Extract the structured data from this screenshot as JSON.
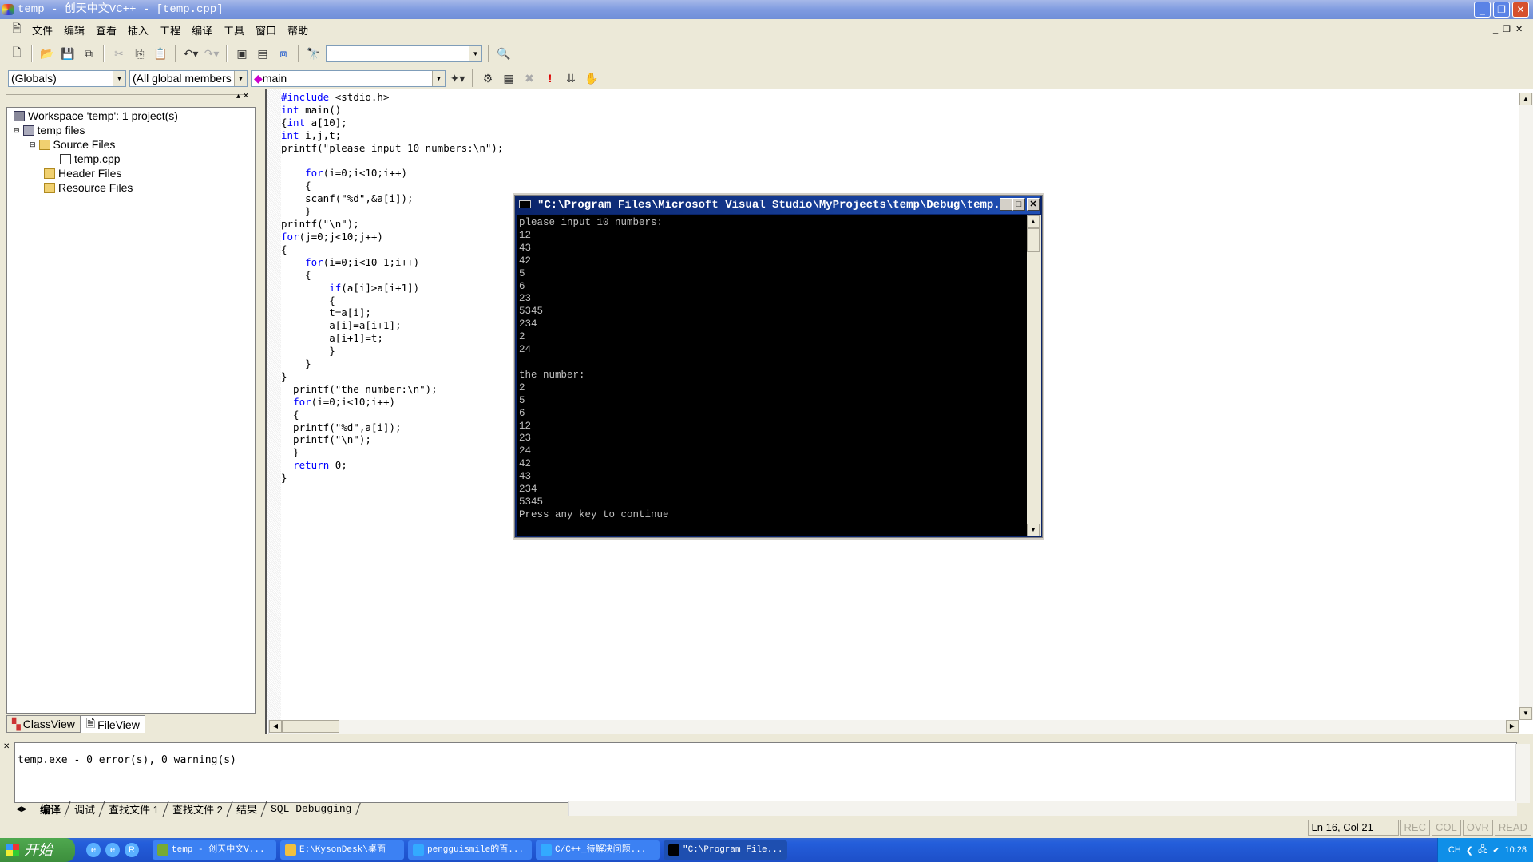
{
  "window": {
    "title": "temp - 创天中文VC++ - [temp.cpp]"
  },
  "menu": [
    "文件",
    "编辑",
    "查看",
    "插入",
    "工程",
    "编译",
    "工具",
    "窗口",
    "帮助"
  ],
  "toolbar": {
    "find_combo_value": ""
  },
  "wizardbar": {
    "class_combo": "(Globals)",
    "filter_combo": "(All global members",
    "member_combo": "main"
  },
  "workspace": {
    "items": [
      {
        "label": "Workspace 'temp': 1 project(s)",
        "icon": "workspace-icon"
      },
      {
        "label": "temp files",
        "icon": "project-icon"
      },
      {
        "label": "Source Files",
        "icon": "folder-open-icon"
      },
      {
        "label": "temp.cpp",
        "icon": "cpp-file-icon"
      },
      {
        "label": "Header Files",
        "icon": "folder-icon"
      },
      {
        "label": "Resource Files",
        "icon": "folder-icon"
      }
    ],
    "tabs": [
      "ClassView",
      "FileView"
    ]
  },
  "editor": {
    "lines": [
      "#include <stdio.h>",
      "int main()",
      "{int a[10];",
      "int i,j,t;",
      "printf(\"please input 10 numbers:\\n\");",
      "",
      "    for(i=0;i<10;i++)",
      "    {",
      "    scanf(\"%d\",&a[i]);",
      "    }",
      "printf(\"\\n\");",
      "for(j=0;j<10;j++)",
      "{",
      "    for(i=0;i<10-1;i++)",
      "    {",
      "        if(a[i]>a[i+1])",
      "        {",
      "        t=a[i];",
      "        a[i]=a[i+1];",
      "        a[i+1]=t;",
      "        }",
      "    }",
      "}",
      "  printf(\"the number:\\n\");",
      "  for(i=0;i<10;i++)",
      "  {",
      "  printf(\"%d\",a[i]);",
      "  printf(\"\\n\");",
      "  }",
      "  return 0;",
      "}"
    ]
  },
  "console": {
    "title": "\"C:\\Program Files\\Microsoft Visual Studio\\MyProjects\\temp\\Debug\\temp....",
    "lines": [
      "please input 10 numbers:",
      "12",
      "43",
      "42",
      "5",
      "6",
      "23",
      "5345",
      "234",
      "2",
      "24",
      "",
      "the number:",
      "2",
      "5",
      "6",
      "12",
      "23",
      "24",
      "42",
      "43",
      "234",
      "5345",
      "Press any key to continue"
    ]
  },
  "output": {
    "text": "temp.exe - 0 error(s), 0 warning(s)",
    "tabs": [
      "编译",
      "调试",
      "查找文件 1",
      "查找文件 2",
      "结果",
      "SQL Debugging"
    ]
  },
  "statusbar": {
    "position": "Ln 16, Col 21",
    "indicators": [
      "REC",
      "COL",
      "OVR",
      "READ"
    ]
  },
  "taskbar": {
    "start": "开始",
    "tasks": [
      {
        "label": "temp - 创天中文V...",
        "color": "#7a3"
      },
      {
        "label": "E:\\KysonDesk\\桌面",
        "color": "#f0c040"
      },
      {
        "label": "pengguismile的百...",
        "color": "#3af"
      },
      {
        "label": "C/C++_待解决问题...",
        "color": "#3af"
      },
      {
        "label": "\"C:\\Program File...",
        "color": "#000"
      }
    ],
    "tray": {
      "lang": "CH",
      "clock": "10:28"
    }
  }
}
